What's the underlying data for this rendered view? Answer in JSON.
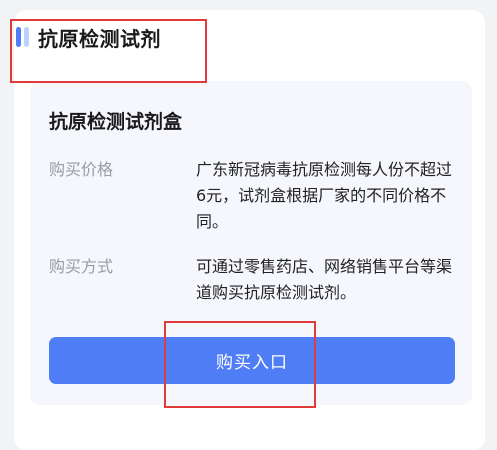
{
  "section": {
    "title": "抗原检测试剂",
    "icon": "title-bars-icon",
    "accent_color": "#4f7df5"
  },
  "panel": {
    "title": "抗原检测试剂盒",
    "rows": [
      {
        "label": "购买价格",
        "value": "广东新冠病毒抗原检测每人份不超过6元，试剂盒根据厂家的不同价格不同。"
      },
      {
        "label": "购买方式",
        "value": "可通过零售药店、网络销售平台等渠道购买抗原检测试剂。"
      }
    ],
    "button_label": "购买入口"
  },
  "highlight_color": "#e03a3a"
}
